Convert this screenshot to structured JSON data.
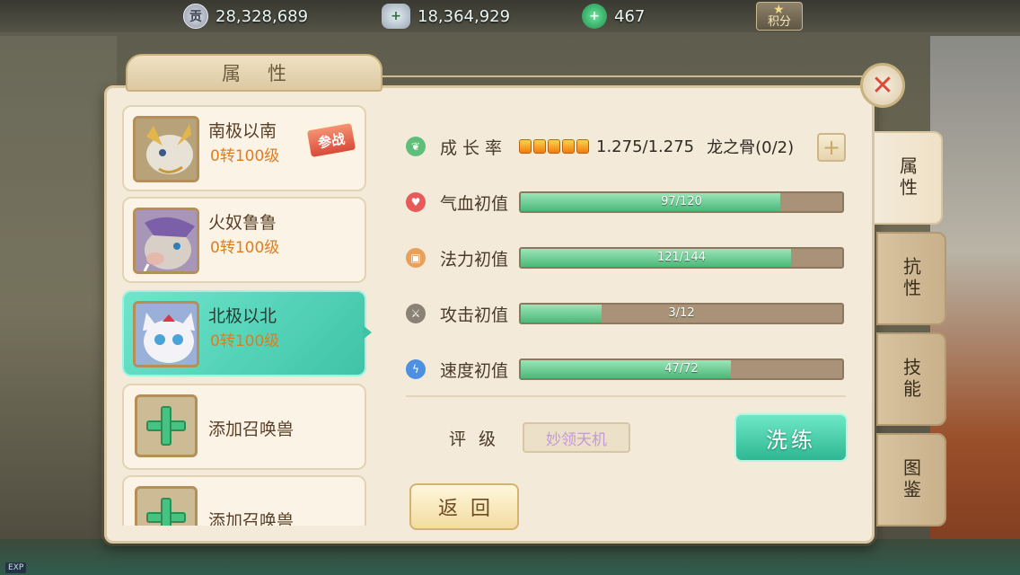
{
  "resources": {
    "contribution": {
      "icon": "contribution-coin-icon",
      "glyph": "贡",
      "value": "28,328,689"
    },
    "silver": {
      "icon": "silver-ingot-icon",
      "glyph": "+",
      "value": "18,364,929"
    },
    "jade": {
      "icon": "jade-icon",
      "glyph": "+",
      "value": "467"
    },
    "score_label": "积分"
  },
  "panel": {
    "title": "属性",
    "close_glyph": "✕"
  },
  "pets": [
    {
      "name": "南极以南",
      "level": "0转100级",
      "badge": "参战",
      "selected": false
    },
    {
      "name": "火奴鲁鲁",
      "level": "0转100级",
      "selected": false
    },
    {
      "name": "北极以北",
      "level": "0转100级",
      "selected": true
    },
    {
      "name": "添加召唤兽",
      "add": true
    },
    {
      "name": "添加召唤兽",
      "add": true
    }
  ],
  "growth": {
    "label": "成长率",
    "stars": 5,
    "value": "1.275/1.275",
    "item": "龙之骨(0/2)",
    "plus": "+"
  },
  "stats": [
    {
      "label": "气血初值",
      "text": "97/120",
      "fraction": 0.808,
      "icon": "heart-icon",
      "color": "#e85a5a"
    },
    {
      "label": "法力初值",
      "text": "121/144",
      "fraction": 0.84,
      "icon": "mana-icon",
      "color": "#e8a05a"
    },
    {
      "label": "攻击初值",
      "text": "3/12",
      "fraction": 0.25,
      "icon": "sword-icon",
      "color": "#8b8174"
    },
    {
      "label": "速度初值",
      "text": "47/72",
      "fraction": 0.653,
      "icon": "speed-icon",
      "color": "#4d8fe0"
    }
  ],
  "rating": {
    "label": "评级",
    "value": "妙领天机"
  },
  "buttons": {
    "wash": "洗练",
    "back": "返回"
  },
  "side_tabs": [
    "属性",
    "抗性",
    "技能",
    "图鉴"
  ],
  "colors": {
    "accent": "#3fc3a7",
    "bar_fill": "#4bb878",
    "level_text": "#e07c1e"
  }
}
